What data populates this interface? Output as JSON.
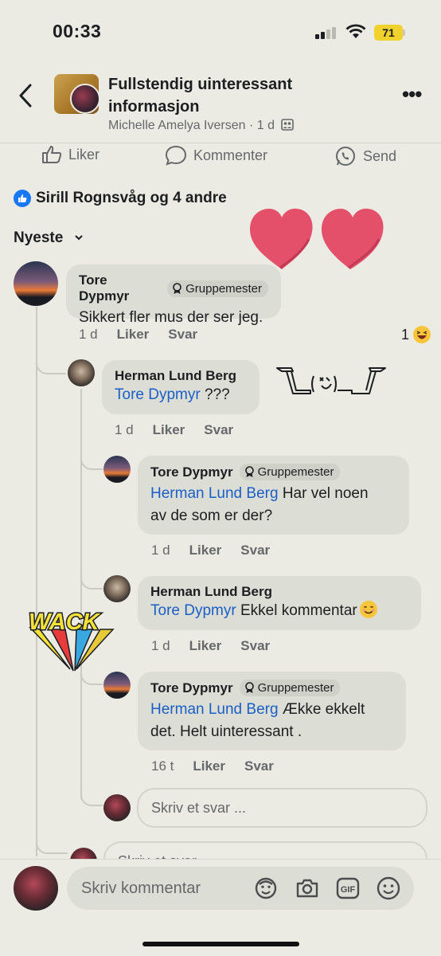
{
  "status_bar": {
    "time": "00:33",
    "battery": "71"
  },
  "header": {
    "title": "Fullstendig uinteressant informasjon",
    "author": "Michelle Amelya Iversen",
    "age": "1 d"
  },
  "post_actions": {
    "like": "Liker",
    "comment": "Kommenter",
    "send": "Send"
  },
  "reactions": {
    "text": "Sirill Rognsvåg og 4 andre"
  },
  "sort": {
    "label": "Nyeste"
  },
  "comments": [
    {
      "author": "Tore Dypmyr",
      "badge": "Gruppemester",
      "text": "Sikkert fler mus der ser jeg.",
      "age": "1 d",
      "like": "Liker",
      "reply": "Svar",
      "reaction_count": "1"
    },
    {
      "author": "Herman Lund Berg",
      "mention": "Tore Dypmyr",
      "text": " ???",
      "age": "1 d",
      "like": "Liker",
      "reply": "Svar"
    },
    {
      "author": "Tore Dypmyr",
      "badge": "Gruppemester",
      "mention": "Herman Lund Berg",
      "text": " Har vel noen",
      "text2": "av de som er der?",
      "age": "1 d",
      "like": "Liker",
      "reply": "Svar"
    },
    {
      "author": "Herman Lund Berg",
      "mention": "Tore Dypmyr",
      "text": " Ekkel kommentar",
      "age": "1 d",
      "like": "Liker",
      "reply": "Svar"
    },
    {
      "author": "Tore Dypmyr",
      "badge": "Gruppemester",
      "mention": "Herman Lund Berg",
      "text": " Ække ekkelt",
      "text2": "det. Helt uinteressant .",
      "age": "16 t",
      "like": "Liker",
      "reply": "Svar"
    }
  ],
  "reply_input": {
    "placeholder": "Skriv et svar ...",
    "placeholder_cut": "Skriv et svar ..."
  },
  "composer": {
    "placeholder": "Skriv kommentar"
  },
  "sticker": {
    "wack": "WACK"
  },
  "colors": {
    "link": "#1a5fc8",
    "like_blue": "#1877f2",
    "heart": "#e6516a",
    "battery": "#f1d22c"
  }
}
